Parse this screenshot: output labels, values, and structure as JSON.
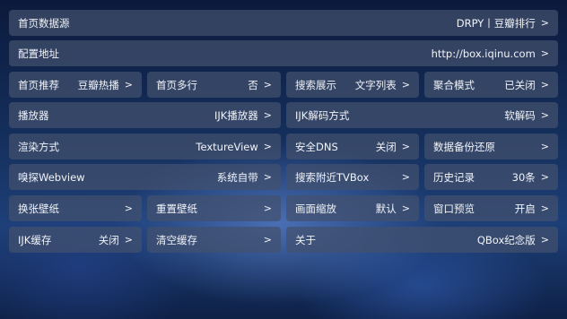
{
  "rows": {
    "home_source": {
      "label": "首页数据源",
      "value": "DRPY丨豆瓣排行"
    },
    "config_url": {
      "label": "配置地址",
      "value": "http://box.iqinu.com"
    },
    "home_rec": {
      "label": "首页推荐",
      "value": "豆瓣热播"
    },
    "home_multi": {
      "label": "首页多行",
      "value": "否"
    },
    "search_display": {
      "label": "搜索展示",
      "value": "文字列表"
    },
    "agg_mode": {
      "label": "聚合模式",
      "value": "已关闭"
    },
    "player": {
      "label": "播放器",
      "value": "IJK播放器"
    },
    "ijk_decode": {
      "label": "IJK解码方式",
      "value": "软解码"
    },
    "render": {
      "label": "渲染方式",
      "value": "TextureView"
    },
    "safe_dns": {
      "label": "安全DNS",
      "value": "关闭"
    },
    "backup": {
      "label": "数据备份还原",
      "value": ""
    },
    "sniff": {
      "label": "嗅探Webview",
      "value": "系统自带"
    },
    "search_nearby": {
      "label": "搜索附近TVBox",
      "value": ""
    },
    "history": {
      "label": "历史记录",
      "value": "30条"
    },
    "change_wall": {
      "label": "换张壁纸",
      "value": ""
    },
    "reset_wall": {
      "label": "重置壁纸",
      "value": ""
    },
    "zoom": {
      "label": "画面缩放",
      "value": "默认"
    },
    "window_preview": {
      "label": "窗口预览",
      "value": "开启"
    },
    "ijk_cache": {
      "label": "IJK缓存",
      "value": "关闭"
    },
    "clear_cache": {
      "label": "清空缓存",
      "value": ""
    },
    "about": {
      "label": "关于",
      "value": "QBox纪念版"
    }
  },
  "arrow": ">"
}
